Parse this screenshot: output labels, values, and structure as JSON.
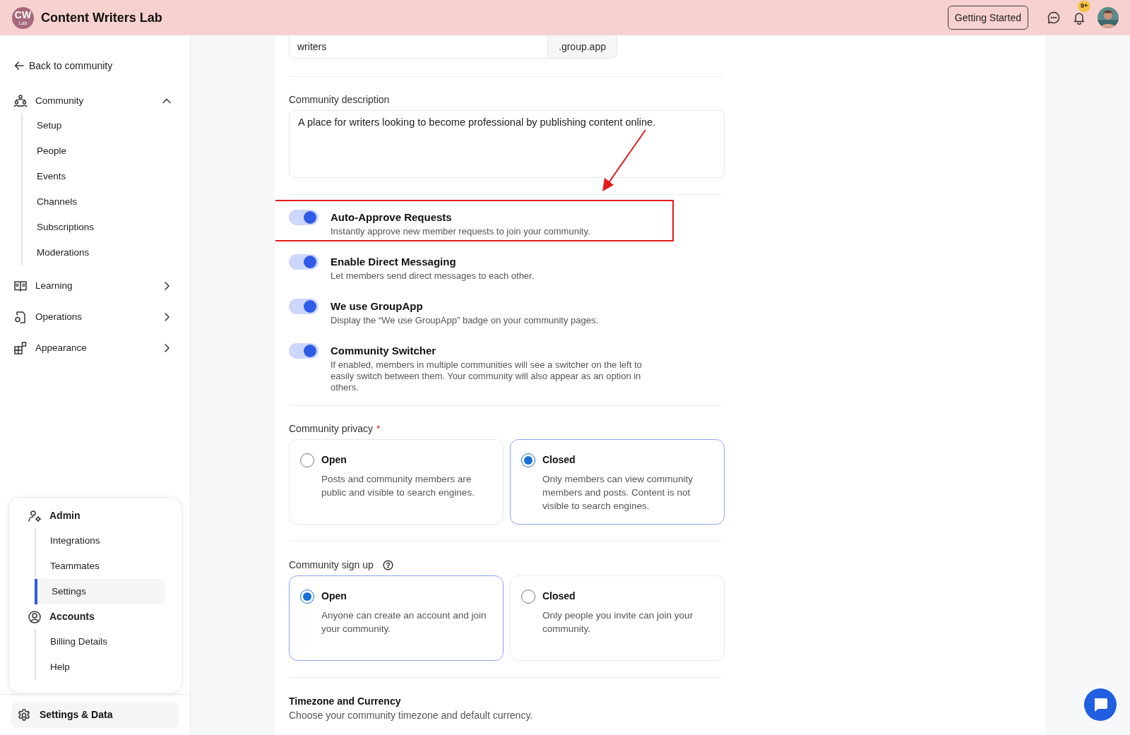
{
  "header": {
    "logo": {
      "initials": "CW",
      "sub": "Lab"
    },
    "title": "Content Writers Lab",
    "button": "Getting Started",
    "notification_badge": "9+"
  },
  "sidebar": {
    "back": "Back to community",
    "sections": [
      {
        "label": "Community",
        "expanded": true,
        "children": [
          {
            "label": "Setup"
          },
          {
            "label": "People"
          },
          {
            "label": "Events"
          },
          {
            "label": "Channels"
          },
          {
            "label": "Subscriptions"
          },
          {
            "label": "Moderations"
          }
        ]
      },
      {
        "label": "Learning",
        "expanded": false
      },
      {
        "label": "Operations",
        "expanded": false
      },
      {
        "label": "Appearance",
        "expanded": false
      }
    ],
    "admin_card": [
      {
        "label": "Admin",
        "children": [
          {
            "label": "Integrations",
            "selected": false
          },
          {
            "label": "Teammates",
            "selected": false
          },
          {
            "label": "Settings",
            "selected": true
          }
        ]
      },
      {
        "label": "Accounts",
        "children": [
          {
            "label": "Billing Details",
            "selected": false
          },
          {
            "label": "Help",
            "selected": false
          }
        ]
      }
    ],
    "footer_button": "Settings & Data"
  },
  "main": {
    "subdomain": {
      "value": "writers",
      "suffix": ".group.app"
    },
    "description": {
      "label": "Community description",
      "value": "A place for writers looking to become professional by publishing content online."
    },
    "toggles": [
      {
        "title": "Auto-Approve Requests",
        "description": "Instantly approve new member requests to join your community.",
        "on": true,
        "highlighted": true
      },
      {
        "title": "Enable Direct Messaging",
        "description": "Let members send direct messages to each other.",
        "on": true,
        "highlighted": false
      },
      {
        "title": "We use GroupApp",
        "description": "Display the “We use GroupApp” badge on your community pages.",
        "on": true,
        "highlighted": false
      },
      {
        "title": "Community Switcher",
        "description": "If enabled, members in multiple communities will see a switcher on the left to easily switch between them. Your community will also appear as an option in others.",
        "on": true,
        "highlighted": false
      }
    ],
    "privacy": {
      "label": "Community privacy",
      "required_mark": "*",
      "options": [
        {
          "title": "Open",
          "description": "Posts and community members are public and visible to search engines.",
          "selected": false
        },
        {
          "title": "Closed",
          "description": "Only members can view community members and posts. Content is not visible to search engines.",
          "selected": true
        }
      ]
    },
    "signup": {
      "label": "Community sign up",
      "options": [
        {
          "title": "Open",
          "description": "Anyone can create an account and join your community.",
          "selected": true
        },
        {
          "title": "Closed",
          "description": "Only people you invite can join your community.",
          "selected": false
        }
      ]
    },
    "timezone": {
      "title": "Timezone and Currency",
      "description": "Choose your community timezone and default currency."
    }
  }
}
